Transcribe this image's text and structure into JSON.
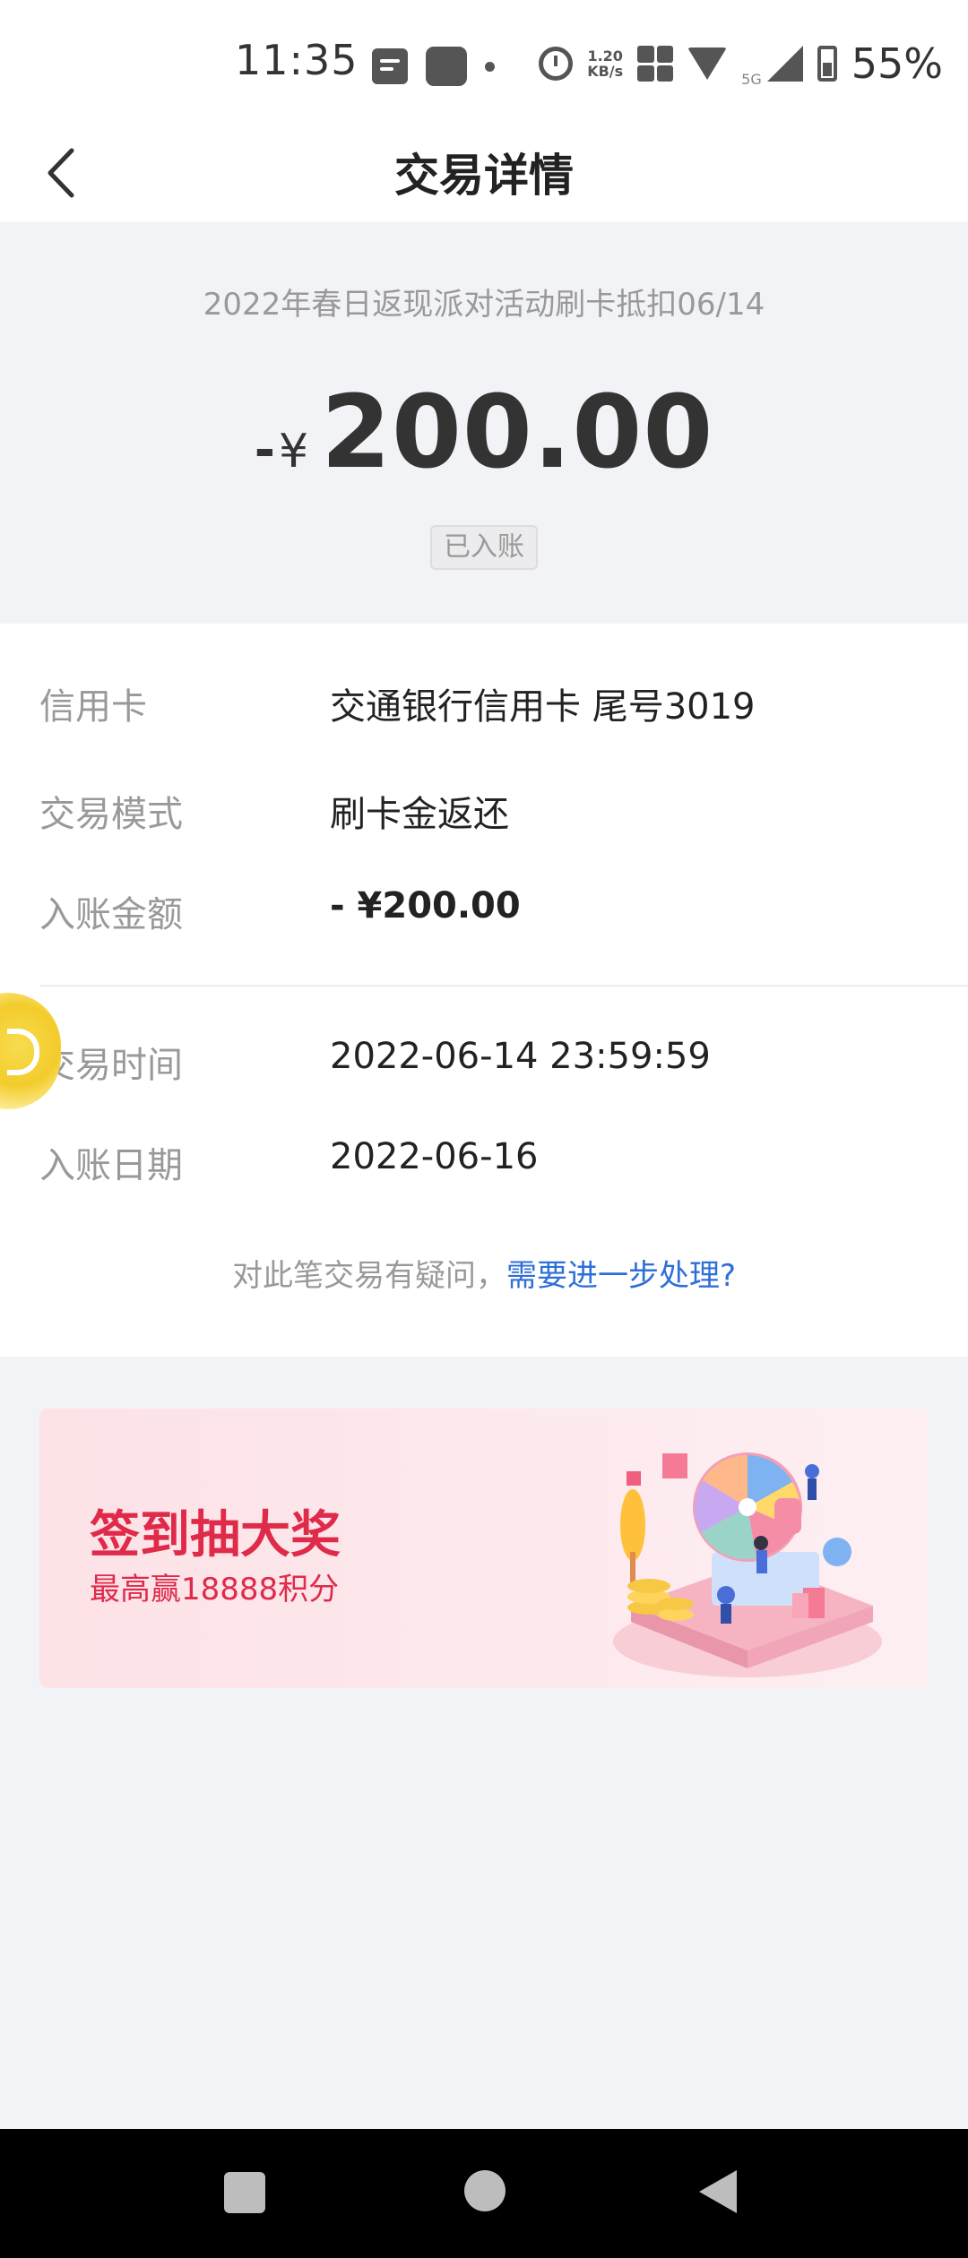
{
  "status_bar": {
    "time": "11:35",
    "net_speed_value": "1.20",
    "net_speed_unit": "KB/s",
    "network_type": "5G",
    "battery": "55%"
  },
  "header": {
    "title": "交易详情"
  },
  "summary": {
    "description": "2022年春日返现派对活动刷卡抵扣06/14",
    "sign": "-",
    "currency": "¥",
    "amount": "200.00",
    "status": "已入账"
  },
  "details": {
    "rows": [
      {
        "label": "信用卡",
        "value": "交通银行信用卡 尾号3019"
      },
      {
        "label": "交易模式",
        "value": "刷卡金返还"
      },
      {
        "label": "入账金额",
        "value": "- ¥200.00"
      },
      {
        "label": "交易时间",
        "value": "2022-06-14 23:59:59"
      },
      {
        "label": "入账日期",
        "value": "2022-06-16"
      }
    ],
    "query_text": "对此笔交易有疑问，",
    "query_link": "需要进一步处理?"
  },
  "banner": {
    "title": "签到抽大奖",
    "subtitle": "最高赢18888积分"
  },
  "colors": {
    "link": "#2f6fd8",
    "banner_red": "#e02a4a",
    "background": "#f2f3f6"
  }
}
